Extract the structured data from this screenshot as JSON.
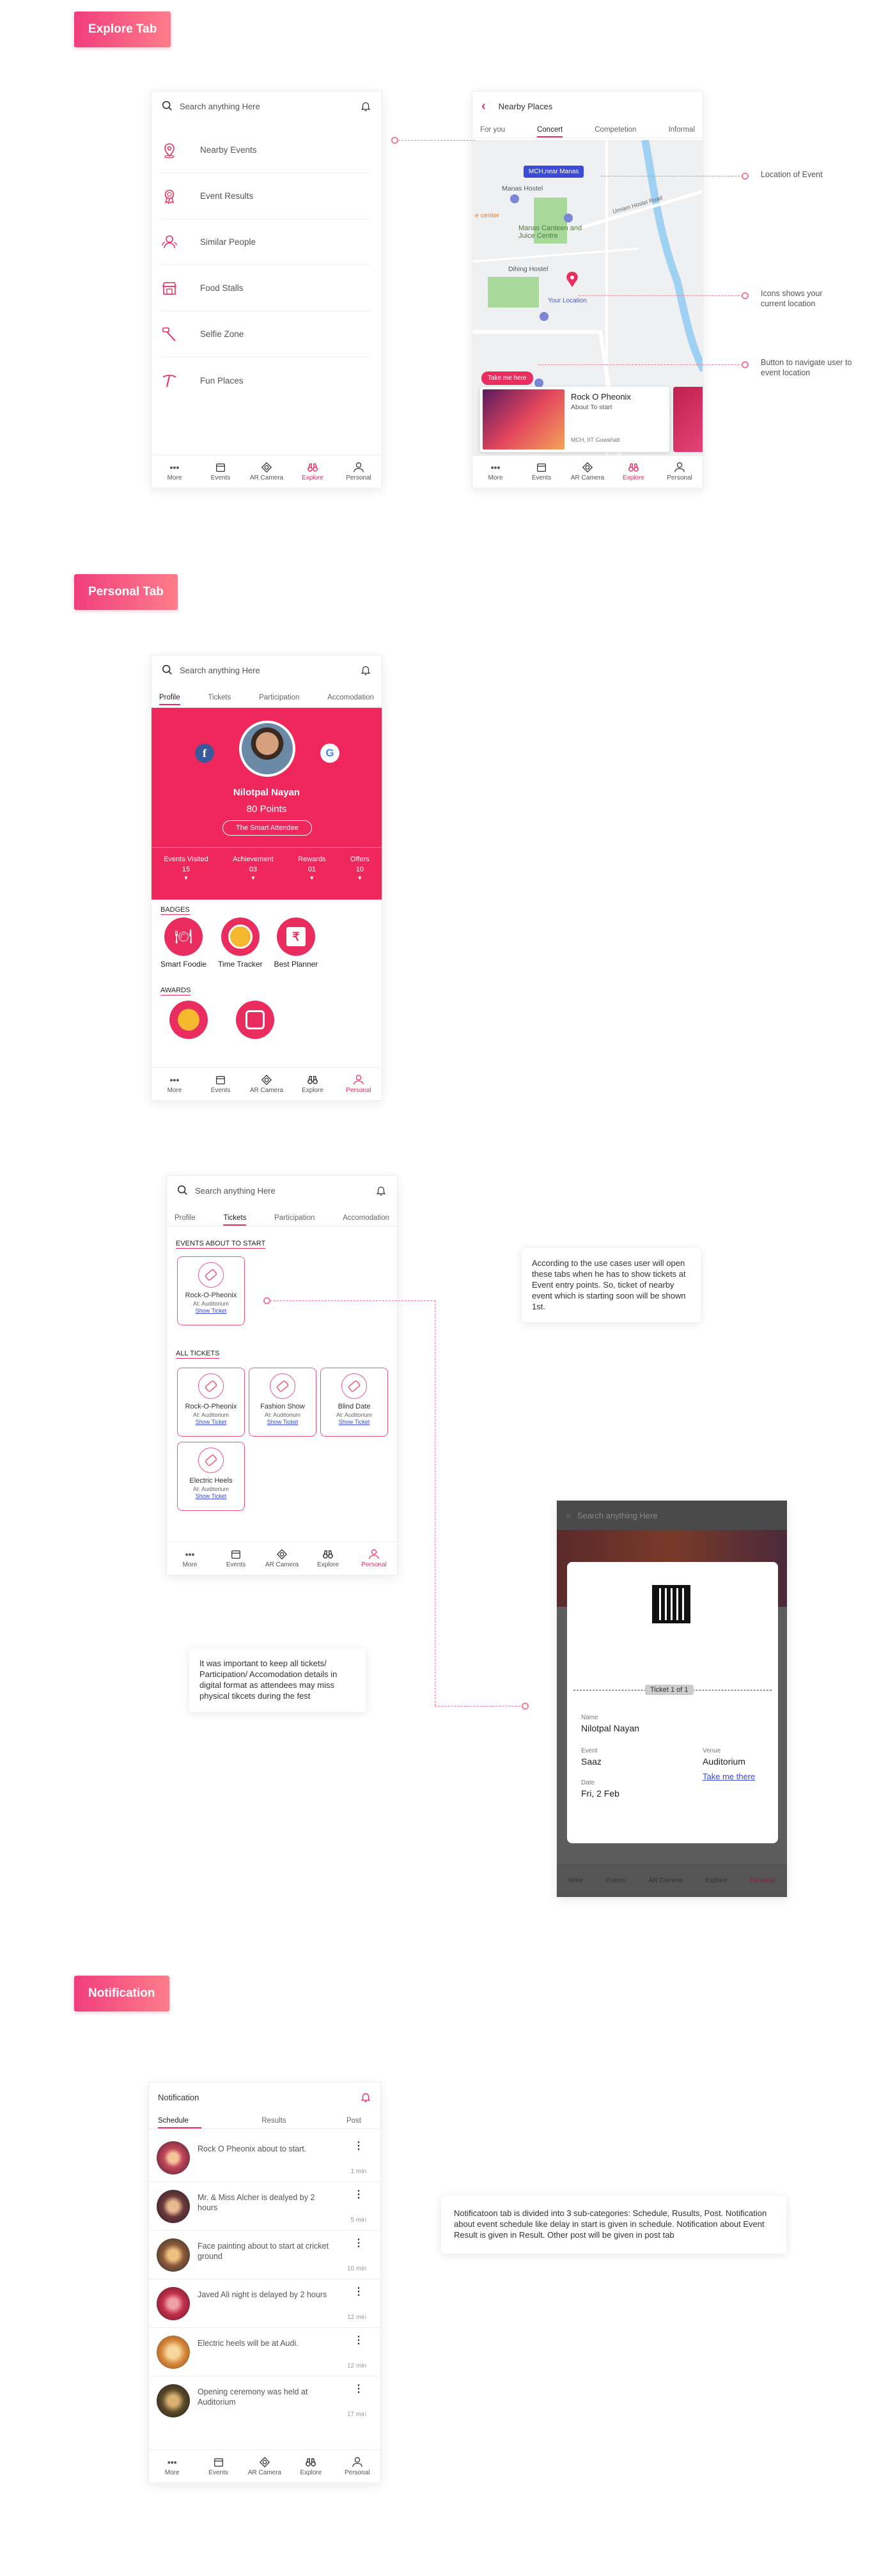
{
  "sections": {
    "explore": "Explore Tab",
    "personal": "Personal Tab",
    "notification": "Notification"
  },
  "search": {
    "placeholder": "Search anything Here"
  },
  "nav": [
    "More",
    "Events",
    "AR Camera",
    "Explore",
    "Personal"
  ],
  "explore_menu": [
    "Nearby Events",
    "Event Results",
    "Similar People",
    "Food Stalls",
    "Selfie Zone",
    "Fun Places"
  ],
  "nearby": {
    "title": "Nearby Places",
    "tabs": [
      "For you",
      "Concert",
      "Competetion",
      "Informal"
    ],
    "map": {
      "pin": "MCH,near Manas",
      "hostel": "Manas Hostel",
      "center": "e center",
      "canteen": "Manas Canteen and Juice Centre",
      "road": "Umiam Hostel Road",
      "dihing": "Dihing Hostel",
      "yourloc": "Your Location"
    },
    "takeme": "Take me here",
    "card": {
      "title": "Rock O Pheonix",
      "sub": "About To start",
      "place": "MCH, IIT Guwahati"
    }
  },
  "annotations": [
    "Location of Event",
    "Icons shows your current location",
    "Button to navigate user to event location"
  ],
  "profile": {
    "tabs": [
      "Profile",
      "Tickets",
      "Participation",
      "Accomodation"
    ],
    "name": "Nilotpal Nayan",
    "points": "80 Points",
    "title": "The Smart Attendee",
    "stats": [
      {
        "label": "Events Visited",
        "value": "15"
      },
      {
        "label": "Achievement",
        "value": "03"
      },
      {
        "label": "Rewards",
        "value": "01"
      },
      {
        "label": "Offers",
        "value": "10"
      }
    ],
    "badges_h": "BADGES",
    "badges": [
      "Smart Foodie",
      "Time Tracker",
      "Best Planner"
    ],
    "awards_h": "AWARDS"
  },
  "tickets": {
    "about_h": "EVENTS ABOUT TO START",
    "all_h": "ALL TICKETS",
    "about": [
      {
        "name": "Rock-O-Pheonix",
        "venue": "At: Auditorium",
        "link": "Show Ticket"
      }
    ],
    "all": [
      {
        "name": "Rock-O-Pheonix",
        "venue": "At: Auditorium",
        "link": "Show Ticket"
      },
      {
        "name": "Fashion Show",
        "venue": "At: Auditorium",
        "link": "Show Ticket"
      },
      {
        "name": "Blind Date",
        "venue": "At: Auditorium",
        "link": "Show Ticket"
      },
      {
        "name": "Electric Heels",
        "venue": "At: Auditorium",
        "link": "Show Ticket"
      }
    ]
  },
  "notes": {
    "tickets": "According to the use cases user will open these tabs when he has to show tickets at Event entry points. So, ticket of nearby event which is starting soon will be shown 1st.",
    "keep": "It was important to keep all tickets/ Participation/ Accomodation details in digital format as attendees may miss physical tikcets during the fest",
    "notif": "Notificatoon tab is divided into 3 sub-categories: Schedule, Rusults, Post. Notification about event schedule like delay in start is given in schedule. Notification about Event Result is given in Result. Other post will be given in post tab"
  },
  "ticket_modal": {
    "label": "Ticket 1 of 1",
    "name_l": "Name",
    "name": "Nilotpal Nayan",
    "event_l": "Event",
    "event": "Saaz",
    "venue_l": "Venue",
    "venue": "Auditorium",
    "date_l": "Date",
    "date": "Fri, 2 Feb",
    "link": "Take me there"
  },
  "notification": {
    "title": "Notification",
    "tabs": [
      "Schedule",
      "Results",
      "Post"
    ],
    "items": [
      {
        "msg": "Rock O Pheonix about to start.",
        "time": "1 min"
      },
      {
        "msg": "Mr. & Miss Alcher is dealyed by 2 hours",
        "time": "5 min"
      },
      {
        "msg": "Face painting about to start at cricket ground",
        "time": "10 min"
      },
      {
        "msg": "Javed Ali night is delayed by 2 hours",
        "time": "12 min"
      },
      {
        "msg": "Electric heels will be at Audi.",
        "time": "12 min"
      },
      {
        "msg": "Opening ceremony was held at Auditorium",
        "time": "17 min"
      }
    ]
  },
  "colors": {
    "primary": "#e92e5f",
    "accent": "#f07c93",
    "link": "#3b4bd8"
  }
}
